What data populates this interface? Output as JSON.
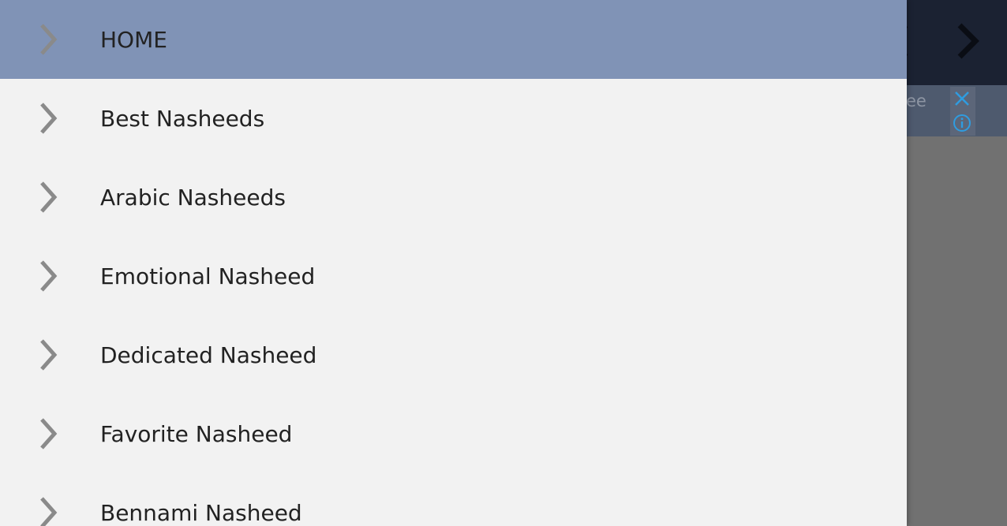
{
  "background": {
    "ad_text": "ee",
    "ad_close_icon": "close-icon",
    "ad_info_icon": "info-icon"
  },
  "drawer": {
    "items": [
      {
        "label": "HOME",
        "icon": "chevron-right-icon",
        "active": true
      },
      {
        "label": "Best Nasheeds",
        "icon": "chevron-right-icon",
        "active": false
      },
      {
        "label": "Arabic Nasheeds",
        "icon": "chevron-right-icon",
        "active": false
      },
      {
        "label": "Emotional Nasheed",
        "icon": "chevron-right-icon",
        "active": false
      },
      {
        "label": "Dedicated Nasheed",
        "icon": "chevron-right-icon",
        "active": false
      },
      {
        "label": "Favorite Nasheed",
        "icon": "chevron-right-icon",
        "active": false
      },
      {
        "label": "Bennami Nasheed",
        "icon": "chevron-right-icon",
        "active": false
      }
    ]
  },
  "colors": {
    "drawer_bg": "#f2f2f2",
    "active_item_bg": "#8093b6",
    "toolbar_bg": "#1b2232",
    "scrim": "#707070",
    "chevron": "#8a8a8a",
    "ad_blue": "#2f9ce0"
  }
}
